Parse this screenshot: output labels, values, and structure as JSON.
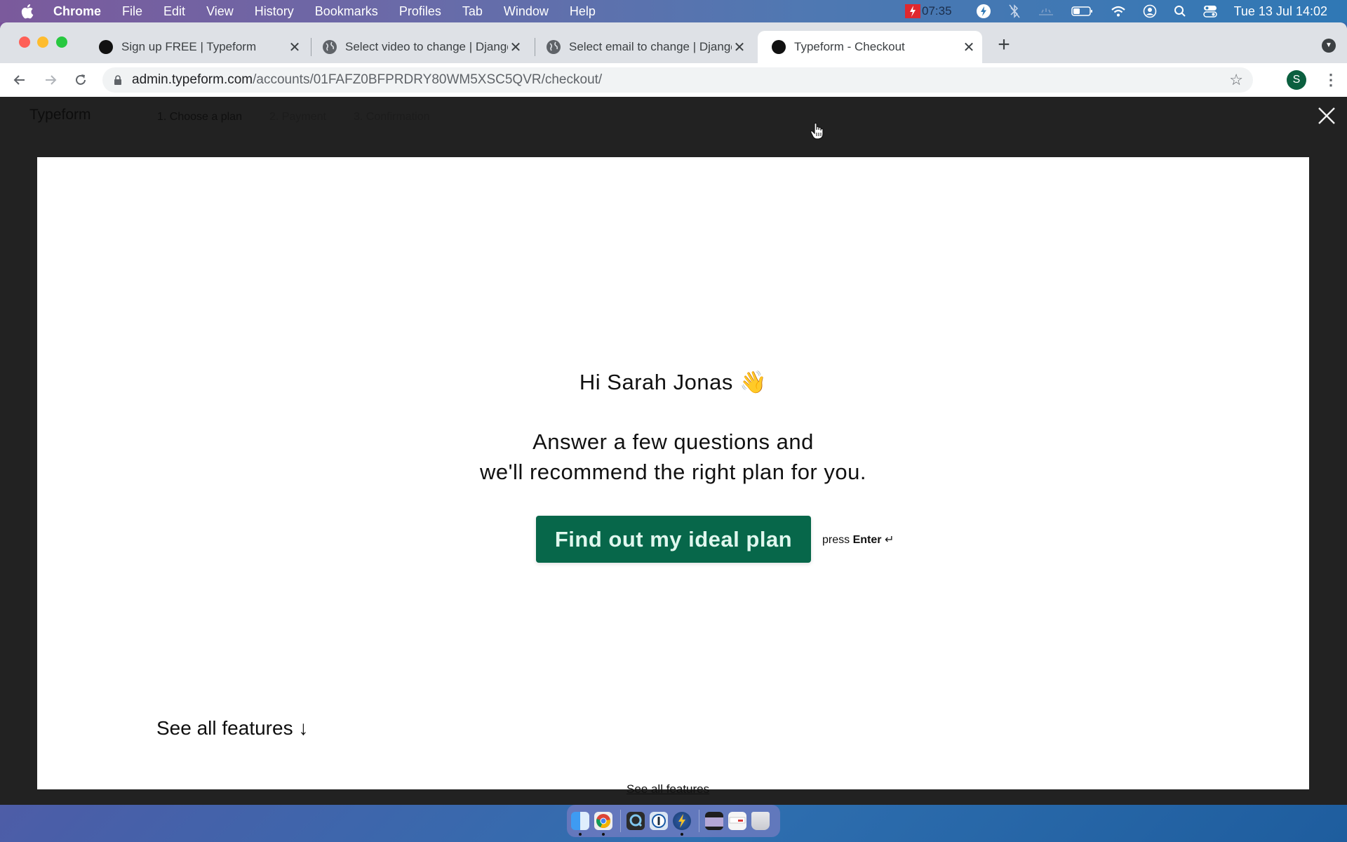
{
  "menubar": {
    "apple_icon": "apple-logo-icon",
    "items": [
      "Chrome",
      "File",
      "Edit",
      "View",
      "History",
      "Bookmarks",
      "Profiles",
      "Tab",
      "Window",
      "Help"
    ],
    "timer": "07:35",
    "status_icons": [
      "lightning-icon",
      "bluetooth-off-icon",
      "wave-icon",
      "battery-icon",
      "wifi-icon",
      "user-account-icon",
      "spotlight-search-icon",
      "control-center-icon"
    ],
    "clock": "Tue 13 Jul  14:02"
  },
  "browser": {
    "tabs": [
      {
        "title": "Sign up FREE | Typeform",
        "favicon": "typeform-dot-icon",
        "active": false
      },
      {
        "title": "Select video to change | Django",
        "favicon": "globe-icon",
        "active": false
      },
      {
        "title": "Select email to change | Django",
        "favicon": "globe-icon",
        "active": false
      },
      {
        "title": "Typeform - Checkout",
        "favicon": "typeform-dot-icon",
        "active": true
      }
    ],
    "new_tab_label": "+",
    "url_host": "admin.typeform.com",
    "url_path": "/accounts/01FAFZ0BFPRDRY80WM5XSC5QVR/checkout/",
    "profile_initial": "S",
    "profile_color": "#0b5f3f"
  },
  "page": {
    "background_header": {
      "logo": "Typeform",
      "steps": [
        "1. Choose a plan",
        "2. Payment",
        "3. Confirmation"
      ]
    },
    "modal": {
      "greeting": "Hi Sarah Jonas",
      "greeting_emoji": "👋",
      "subtitle_line1": "Answer a few questions and",
      "subtitle_line2": "we'll recommend the right plan for you.",
      "cta_label": "Find out my ideal plan",
      "cta_color": "#07674a",
      "hint_prefix": "press",
      "hint_key": "Enter",
      "hint_symbol": "↵"
    },
    "background_footer": {
      "see_all_big": "See all features ↓",
      "see_all_small": "See all features"
    }
  },
  "dock": {
    "apps": [
      "Finder",
      "Google Chrome",
      "QuickTime Player",
      "1Password",
      "Reeder",
      "Screen Recording",
      "Preview Window",
      "Trash"
    ]
  }
}
